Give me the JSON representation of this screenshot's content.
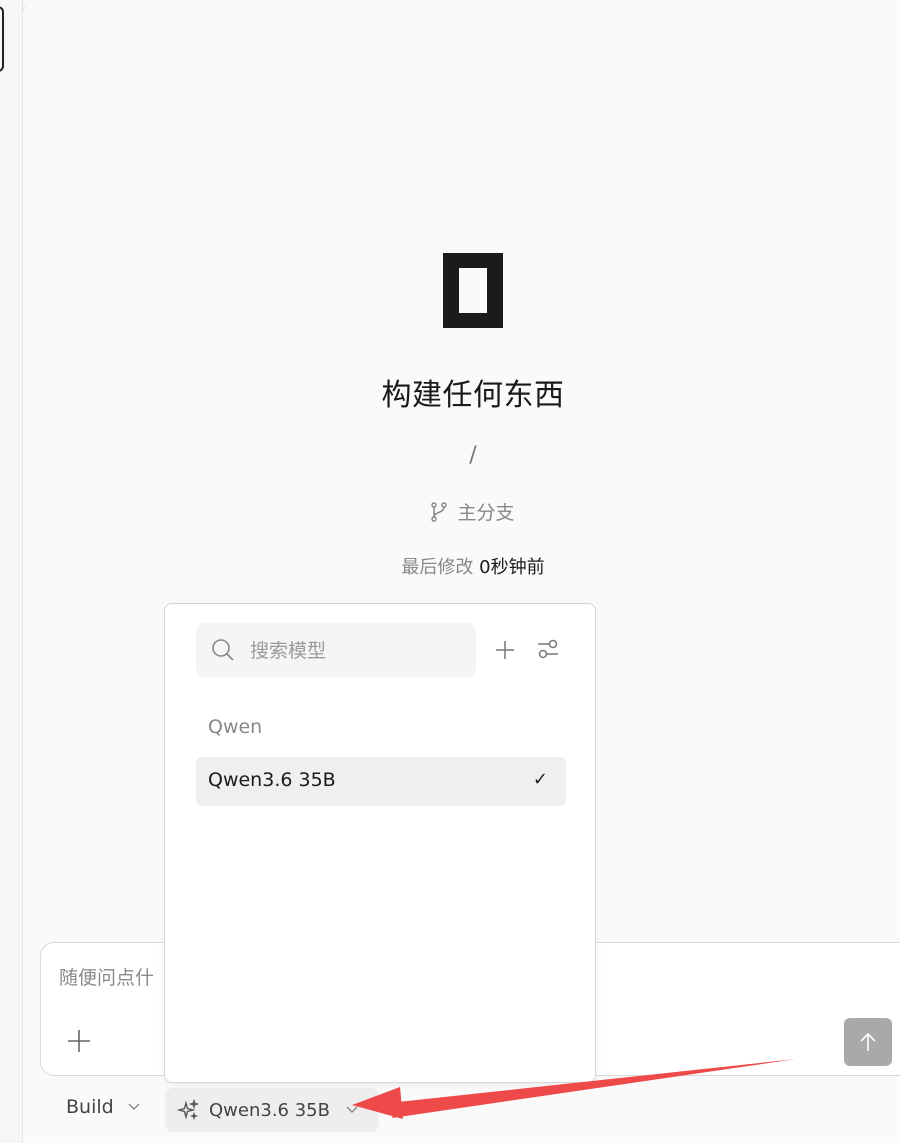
{
  "project": {
    "title": "构建任何东西",
    "path": "/",
    "branch": "主分支",
    "modified_label": "最后修改",
    "modified_time": "0秒钟前"
  },
  "composer": {
    "placeholder": "随便问点什"
  },
  "bottom_bar": {
    "mode": "Build",
    "model": "Qwen3.6 35B"
  },
  "model_dropdown": {
    "search_placeholder": "搜索模型",
    "group_label": "Qwen",
    "items": [
      {
        "label": "Qwen3.6 35B",
        "selected": true,
        "check": "✓"
      }
    ]
  },
  "colors": {
    "annotation_arrow": "#ee4a4a",
    "send_button": "#a9a9a9"
  }
}
